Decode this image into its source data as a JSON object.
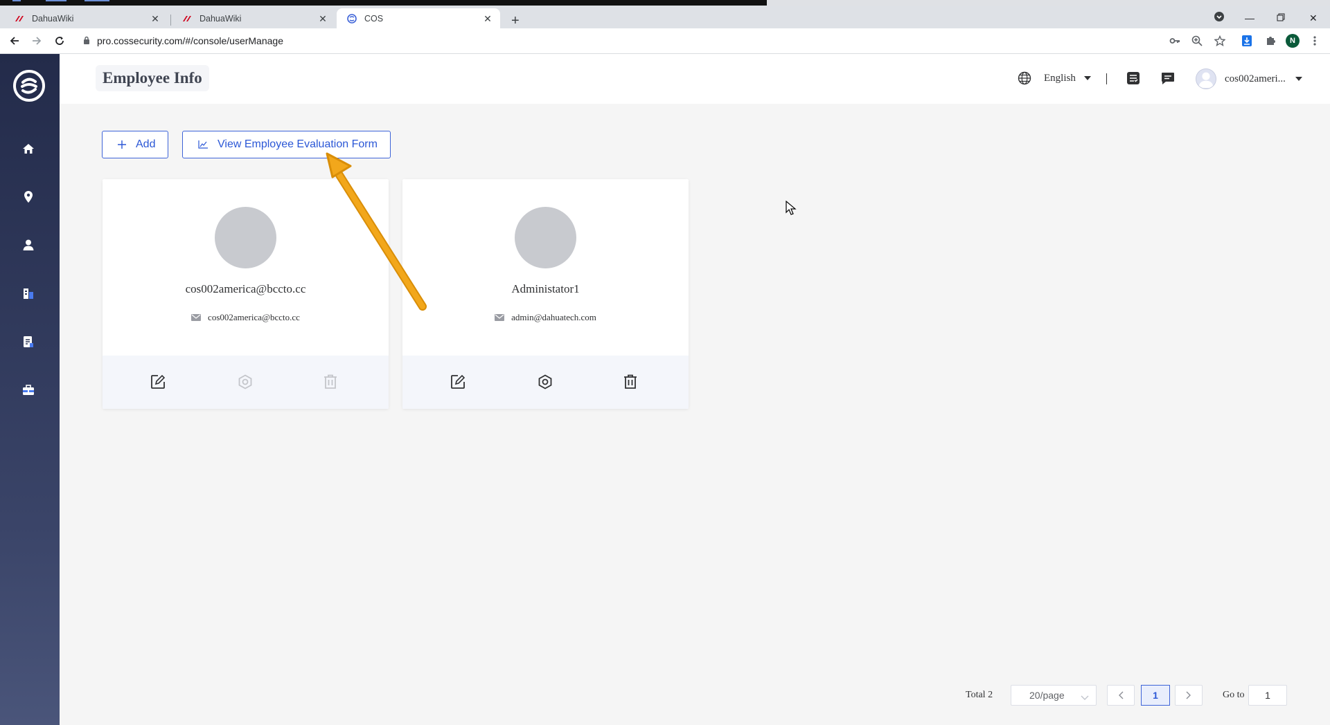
{
  "browser": {
    "tabs": [
      {
        "title": "DahuaWiki",
        "favicon": "dahua-logo-icon",
        "active": false
      },
      {
        "title": "DahuaWiki",
        "favicon": "dahua-logo-icon",
        "active": false
      },
      {
        "title": "COS",
        "favicon": "cos-logo-icon",
        "active": true
      }
    ],
    "url": "pro.cossecurity.com/#/console/userManage",
    "profile_initial": "N"
  },
  "sidebar": {
    "items": [
      {
        "icon": "home-icon"
      },
      {
        "icon": "location-pin-icon"
      },
      {
        "icon": "user-icon"
      },
      {
        "icon": "building-icon"
      },
      {
        "icon": "document-icon"
      },
      {
        "icon": "briefcase-icon"
      }
    ]
  },
  "header": {
    "title": "Employee Info",
    "language": "English",
    "user": "cos002ameri..."
  },
  "toolbar": {
    "add_label": "Add",
    "view_form_label": "View Employee Evaluation Form"
  },
  "employees": [
    {
      "name": "cos002america@bccto.cc",
      "email": "cos002america@bccto.cc",
      "settings_enabled": false,
      "delete_enabled": false
    },
    {
      "name": "Administator1",
      "email": "admin@dahuatech.com",
      "settings_enabled": true,
      "delete_enabled": true
    }
  ],
  "pagination": {
    "total_label": "Total 2",
    "page_size": "20/page",
    "current_page": "1",
    "goto_label": "Go to",
    "goto_value": "1"
  },
  "colors": {
    "accent": "#2b57d6",
    "sidebar_top": "#232b4a",
    "annotation_arrow": "#f2a71b"
  }
}
